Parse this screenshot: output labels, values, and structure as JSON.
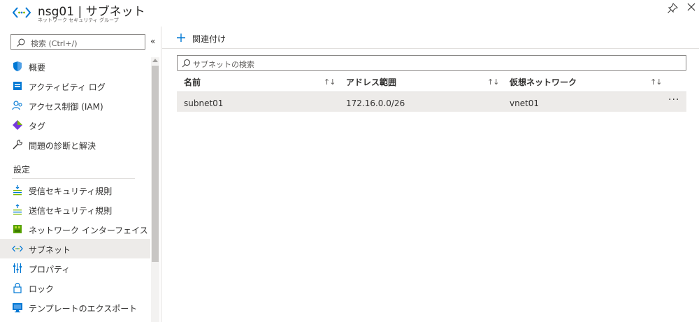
{
  "header": {
    "title": "nsg01 | サブネット",
    "subtitle": "ネットワーク セキュリティ グループ"
  },
  "sidebar": {
    "search_placeholder": "検索 (Ctrl+/)",
    "collapse": "«",
    "items": [
      {
        "label": "概要",
        "icon": "shield-icon"
      },
      {
        "label": "アクティビティ ログ",
        "icon": "activity-log-icon"
      },
      {
        "label": "アクセス制御 (IAM)",
        "icon": "iam-icon"
      },
      {
        "label": "タグ",
        "icon": "tag-icon"
      },
      {
        "label": "問題の診断と解決",
        "icon": "wrench-icon"
      }
    ],
    "section": "設定",
    "settings": [
      {
        "label": "受信セキュリティ規則",
        "icon": "inbound-rules-icon"
      },
      {
        "label": "送信セキュリティ規則",
        "icon": "outbound-rules-icon"
      },
      {
        "label": "ネットワーク インターフェイス",
        "icon": "network-interface-icon"
      },
      {
        "label": "サブネット",
        "icon": "subnet-icon",
        "active": true
      },
      {
        "label": "プロパティ",
        "icon": "properties-icon"
      },
      {
        "label": "ロック",
        "icon": "lock-icon"
      },
      {
        "label": "テンプレートのエクスポート",
        "icon": "export-template-icon"
      }
    ]
  },
  "toolbar": {
    "associate_label": "関連付け"
  },
  "filter": {
    "placeholder": "サブネットの検索"
  },
  "table": {
    "columns": [
      "名前",
      "アドレス範囲",
      "仮想ネットワーク"
    ],
    "sort_glyph": "↑↓",
    "rows": [
      {
        "name": "subnet01",
        "address": "172.16.0.0/26",
        "vnet": "vnet01",
        "more": "···"
      }
    ]
  },
  "colors": {
    "accent": "#0078d4",
    "selected_bg": "#edebe9",
    "border": "#e1dfdd"
  }
}
